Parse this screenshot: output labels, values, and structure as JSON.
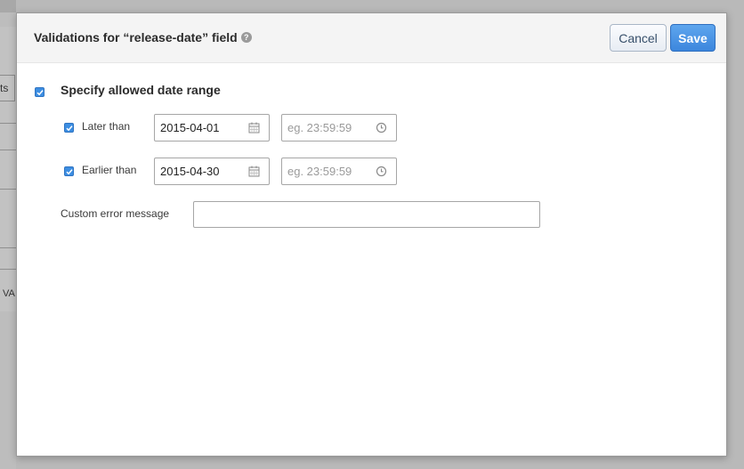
{
  "background": {
    "side_text_1": "ts",
    "side_text_2": "VA"
  },
  "modal": {
    "title": "Validations for “release-date” field",
    "help_icon": "question-circle-icon",
    "cancel_label": "Cancel",
    "save_label": "Save",
    "specify_range": {
      "label": "Specify allowed date range",
      "checked": true
    },
    "later_than": {
      "label": "Later than",
      "checked": true,
      "date_value": "2015-04-01",
      "time_placeholder": "eg. 23:59:59",
      "date_icon": "calendar-icon",
      "time_icon": "clock-icon"
    },
    "earlier_than": {
      "label": "Earlier than",
      "checked": true,
      "date_value": "2015-04-30",
      "time_placeholder": "eg. 23:59:59",
      "date_icon": "calendar-icon",
      "time_icon": "clock-icon"
    },
    "custom_error": {
      "label": "Custom error message",
      "value": ""
    }
  },
  "colors": {
    "primary": "#3d8ee2",
    "overlay": "#b9b9b9"
  }
}
